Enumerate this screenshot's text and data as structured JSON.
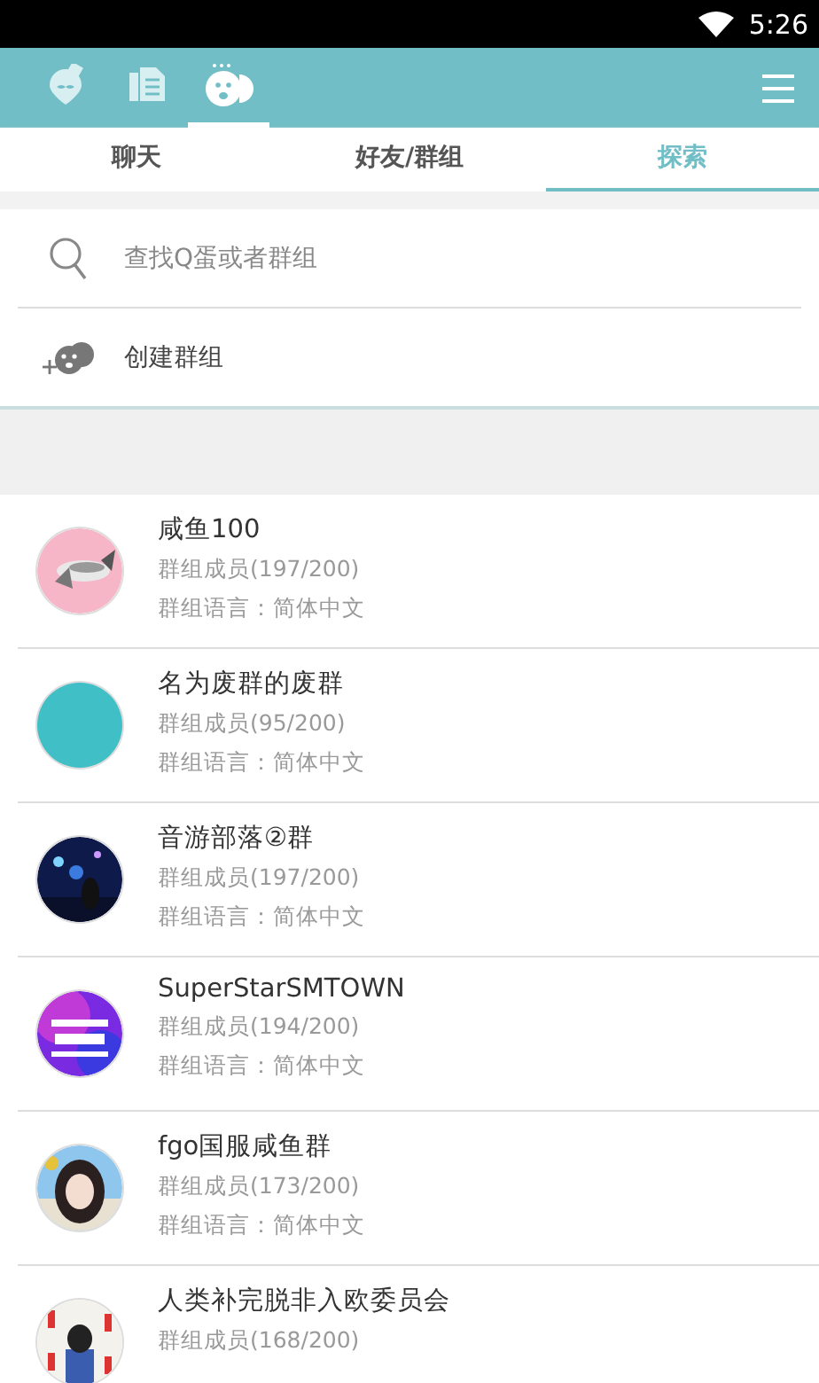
{
  "status_bar": {
    "time": "5:26"
  },
  "nav_icons": [
    {
      "kind": "chat",
      "selected": false
    },
    {
      "kind": "contacts",
      "selected": false
    },
    {
      "kind": "explore",
      "selected": true
    }
  ],
  "tabs": [
    {
      "label": "聊天",
      "selected": false
    },
    {
      "label": "好友/群组",
      "selected": false
    },
    {
      "label": "探索",
      "selected": true
    }
  ],
  "search": {
    "placeholder": "查找Q蛋或者群组"
  },
  "create_group": {
    "label": "创建群组"
  },
  "groups": [
    {
      "name": "咸鱼100",
      "members": "群组成员(197/200)",
      "language": "群组语言：简体中文"
    },
    {
      "name": "名为废群的废群",
      "members": "群组成员(95/200)",
      "language": "群组语言：简体中文",
      "avatar": {
        "kind": "plain",
        "color": "#41bfc6"
      }
    },
    {
      "name": "音游部落②群",
      "members": "群组成员(197/200)",
      "language": "群组语言：简体中文"
    },
    {
      "name": "SuperStarSMTOWN",
      "members": "群组成员(194/200)",
      "language": "群组语言：简体中文"
    },
    {
      "name": "fgo国服咸鱼群",
      "members": "群组成员(173/200)",
      "language": "群组语言：简体中文"
    },
    {
      "name": "人类补完脱非入欧委员会",
      "members": "群组成员(168/200)"
    }
  ]
}
